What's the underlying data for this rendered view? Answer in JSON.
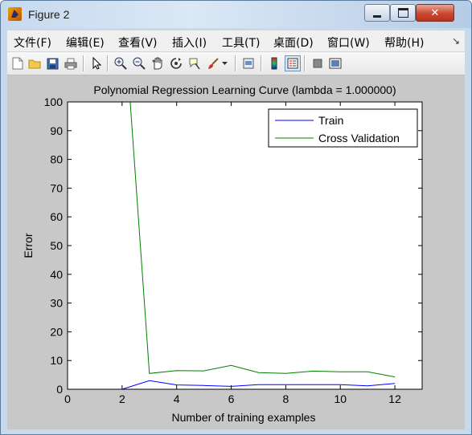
{
  "window": {
    "title": "Figure 2",
    "controls": {
      "minimize": "minimize",
      "maximize": "maximize",
      "close": "✕"
    }
  },
  "menu": {
    "items": [
      "文件(F)",
      "编辑(E)",
      "查看(V)",
      "插入(I)",
      "工具(T)",
      "桌面(D)",
      "窗口(W)",
      "帮助(H)"
    ],
    "overflow": "↘"
  },
  "toolbar": {
    "icons": [
      "new-file-icon",
      "open-folder-icon",
      "save-icon",
      "print-icon",
      "pointer-icon",
      "zoom-in-icon",
      "zoom-out-icon",
      "pan-hand-icon",
      "rotate-3d-icon",
      "data-cursor-icon",
      "brush-icon",
      "print-preview-icon",
      "colorbar-icon",
      "legend-icon",
      "hide-plot-tools-icon",
      "show-plot-tools-icon"
    ]
  },
  "chart_data": {
    "type": "line",
    "title": "Polynomial Regression Learning Curve (lambda = 1.000000)",
    "xlabel": "Number of training examples",
    "ylabel": "Error",
    "xlim": [
      0,
      13
    ],
    "ylim": [
      0,
      100
    ],
    "xticks": [
      0,
      2,
      4,
      6,
      8,
      10,
      12
    ],
    "yticks": [
      0,
      10,
      20,
      30,
      40,
      50,
      60,
      70,
      80,
      90,
      100
    ],
    "legend_position": "top-right",
    "series": [
      {
        "name": "Train",
        "color": "#0000ff",
        "x": [
          1,
          2,
          3,
          4,
          5,
          6,
          7,
          8,
          9,
          10,
          11,
          12
        ],
        "y": [
          0.0,
          0.0,
          3.0,
          1.5,
          1.3,
          1.0,
          1.6,
          1.6,
          1.6,
          1.6,
          1.2,
          2.0
        ]
      },
      {
        "name": "Cross Validation",
        "color": "#008000",
        "x": [
          1,
          2,
          3,
          4,
          5,
          6,
          7,
          8,
          9,
          10,
          11,
          12
        ],
        "y": [
          200.0,
          140.0,
          5.5,
          6.5,
          6.4,
          8.3,
          5.8,
          5.5,
          6.3,
          6.1,
          6.1,
          4.3
        ]
      }
    ]
  }
}
